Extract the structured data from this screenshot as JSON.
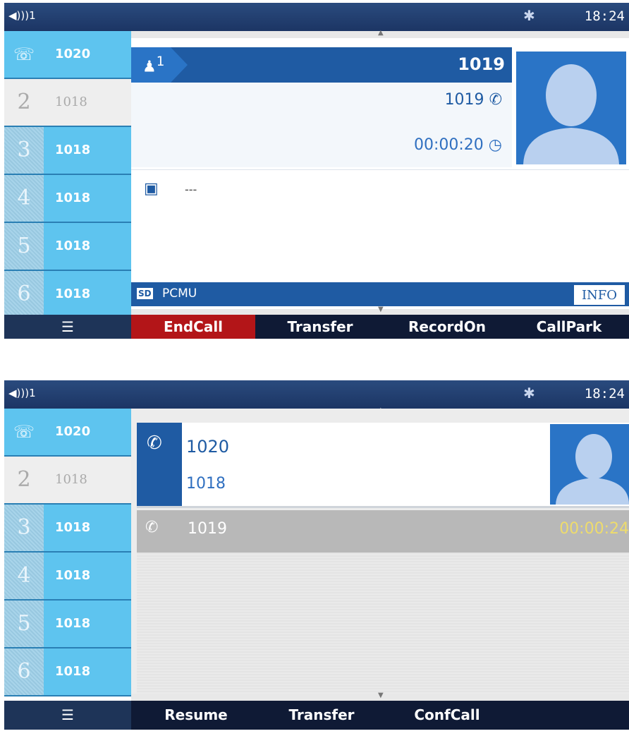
{
  "screen1": {
    "status": {
      "volume": "◀)))1",
      "bluetooth": "✱",
      "time": "18:24"
    },
    "lines": [
      {
        "num": "☏",
        "label": "1020"
      },
      {
        "num": "2",
        "label": "1018"
      },
      {
        "num": "3",
        "label": "1018"
      },
      {
        "num": "4",
        "label": "1018"
      },
      {
        "num": "5",
        "label": "1018"
      },
      {
        "num": "6",
        "label": "1018"
      }
    ],
    "call": {
      "index": "1",
      "name": "1019",
      "number": "1019",
      "duration": "00:00:20"
    },
    "notes": "---",
    "codec_badge": "SD",
    "codec": "PCMU",
    "info_label": "INFO",
    "softkeys": {
      "menu": "☰",
      "end_call": "EndCall",
      "transfer": "Transfer",
      "record": "RecordOn",
      "park": "CallPark"
    }
  },
  "screen2": {
    "status": {
      "volume": "◀)))1",
      "bluetooth": "✱",
      "time": "18:24"
    },
    "lines": [
      {
        "num": "☏",
        "label": "1020"
      },
      {
        "num": "2",
        "label": "1018"
      },
      {
        "num": "3",
        "label": "1018"
      },
      {
        "num": "4",
        "label": "1018"
      },
      {
        "num": "5",
        "label": "1018"
      },
      {
        "num": "6",
        "label": "1018"
      }
    ],
    "active": {
      "name": "1020",
      "number": "1018"
    },
    "held": {
      "number": "1019",
      "duration": "00:00:24"
    },
    "softkeys": {
      "menu": "☰",
      "resume": "Resume",
      "transfer": "Transfer",
      "conf": "ConfCall"
    }
  },
  "colors": {
    "accent": "#1f5ba3",
    "line_key": "#5ec4ef",
    "end_call": "#b31518",
    "held_time": "#eedc6c"
  }
}
